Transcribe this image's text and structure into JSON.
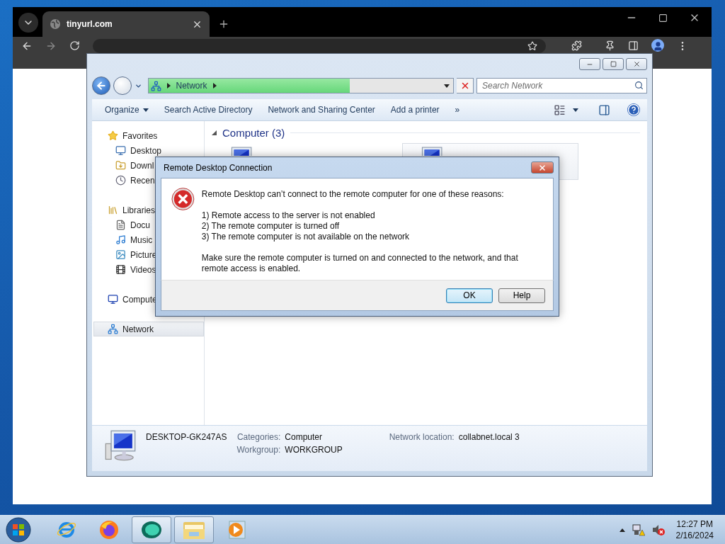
{
  "explorer": {
    "address": {
      "crumb": "Network",
      "level": 0.66
    },
    "search": {
      "placeholder": "Search Network"
    },
    "toolbar": [
      {
        "label": "Organize",
        "dropdown": true
      },
      {
        "label": "Search Active Directory",
        "dropdown": false
      },
      {
        "label": "Network and Sharing Center",
        "dropdown": false
      },
      {
        "label": "Add a printer",
        "dropdown": false
      }
    ],
    "overflow": "»",
    "sidebar": [
      {
        "label": "Favorites",
        "selected": false,
        "children": [
          {
            "label": "Desktop",
            "selected": false
          },
          {
            "label": "Downl",
            "selected": false
          },
          {
            "label": "Recen",
            "selected": false
          }
        ]
      },
      {
        "label": "Libraries",
        "selected": false,
        "children": [
          {
            "label": "Docu",
            "selected": false
          },
          {
            "label": "Music",
            "selected": false
          },
          {
            "label": "Picture",
            "selected": false
          },
          {
            "label": "Videos",
            "selected": false
          }
        ]
      },
      {
        "label": "Compute",
        "selected": false
      },
      {
        "label": "Network",
        "selected": true
      }
    ],
    "group": {
      "title": "Computer (3)",
      "expanded": true,
      "items": [
        {
          "selected": false
        },
        {
          "selected": true
        }
      ]
    },
    "details": {
      "name": "DESKTOP-GK247AS",
      "fields": [
        {
          "label": "Categories:",
          "value": "Computer"
        },
        {
          "label": "Workgroup:",
          "value": "WORKGROUP"
        },
        {
          "label": "Network location:",
          "value": "collabnet.local 3"
        }
      ]
    }
  },
  "browser": {
    "tab": {
      "title": "tinyurl.com"
    }
  },
  "dialog": {
    "title": "Remote Desktop Connection",
    "message": "Remote Desktop can’t connect to the remote computer for one of these reasons:",
    "reasons": [
      "1) Remote access to the server is not enabled",
      "2) The remote computer is turned off",
      "3) The remote computer is not available on the network"
    ],
    "note": "Make sure the remote computer is turned on and connected to the network, and that remote access is enabled.",
    "buttons": [
      {
        "label": "OK",
        "default": true
      },
      {
        "label": "Help",
        "default": false
      }
    ]
  },
  "taskbar": {
    "apps": [
      {
        "active": false
      },
      {
        "active": false
      },
      {
        "active": true
      },
      {
        "active": true
      },
      {
        "active": false
      }
    ],
    "time": "12:27 PM",
    "date": "2/16/2024"
  }
}
